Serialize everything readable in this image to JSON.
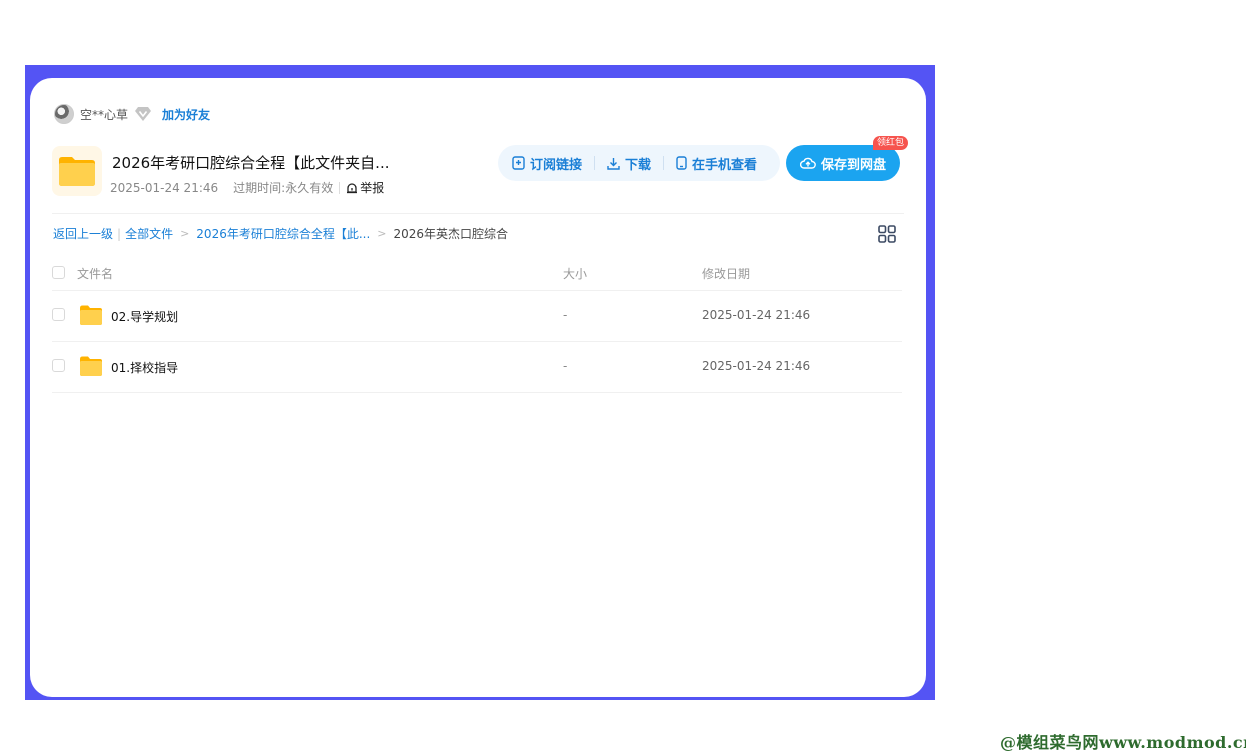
{
  "user": {
    "name": "空**心草",
    "add_friend": "加为好友"
  },
  "share": {
    "title": "2026年考研口腔综合全程【此文件夹自...",
    "date": "2025-01-24 21:46",
    "expiry_label": "过期时间:",
    "expiry_value": "永久有效",
    "report": "举报"
  },
  "actions": {
    "subscribe": "订阅链接",
    "download": "下载",
    "mobile": "在手机查看",
    "save": "保存到网盘",
    "badge": "领红包"
  },
  "breadcrumb": {
    "back": "返回上一级",
    "all_files": "全部文件",
    "level1": "2026年考研口腔综合全程【此...",
    "current": "2026年英杰口腔综合"
  },
  "table": {
    "headers": {
      "name": "文件名",
      "size": "大小",
      "date": "修改日期"
    },
    "rows": [
      {
        "name": "02.导学规划",
        "size": "-",
        "date": "2025-01-24 21:46"
      },
      {
        "name": "01.择校指导",
        "size": "-",
        "date": "2025-01-24 21:46"
      }
    ]
  },
  "watermark": "@模组菜鸟网www.modmod.cn",
  "colors": {
    "frame": "#5454f4",
    "accent": "#1a7fd6",
    "save_button": "#1ba4f0",
    "badge": "#f6544e",
    "folder": "#ffc53d"
  },
  "icons": [
    "vip-diamond-icon",
    "folder-icon",
    "subscribe-icon",
    "download-icon",
    "phone-icon",
    "cloud-upload-icon",
    "report-icon",
    "grid-view-icon"
  ]
}
